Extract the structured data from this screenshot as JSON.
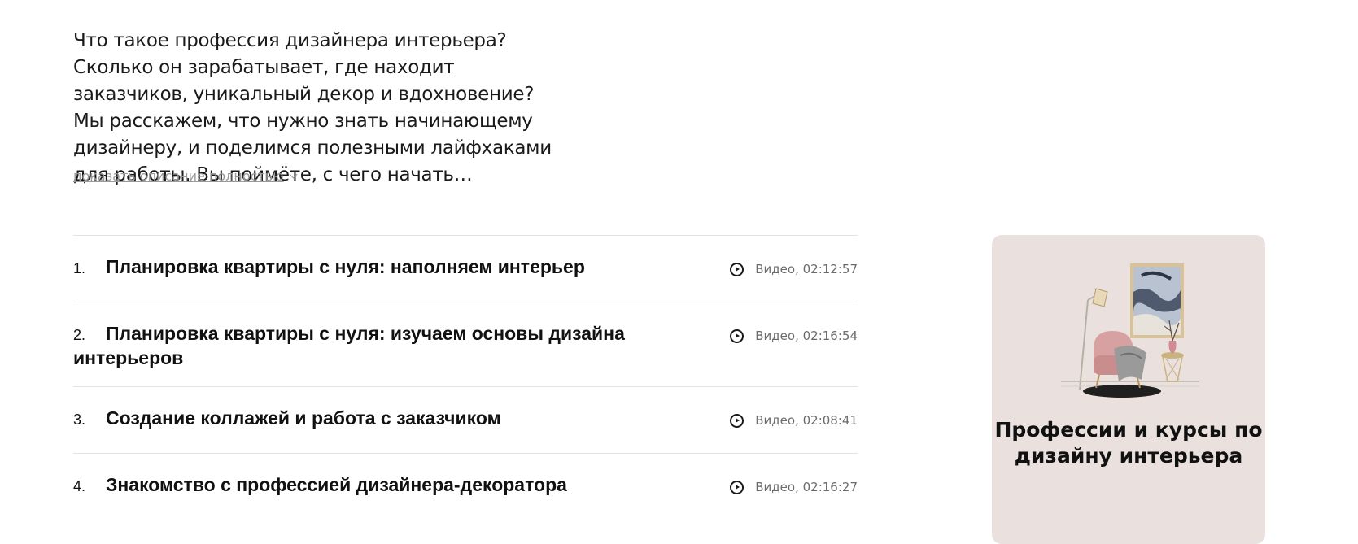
{
  "description": {
    "text": "Что такое профессия дизайнера интерьера? Сколько он зарабатывает, где находит заказчиков, уникальный декор и вдохновение? Мы расскажем, что нужно знать начинающему дизайнеру, и поделимся полезными лайфхаками для работы. Вы поймёте, с чего начать…",
    "show_more_label": "показать описание полностью"
  },
  "lessons": [
    {
      "number": "1.",
      "title": "Планировка квартиры с нуля: наполняем интерьер",
      "meta": "Видео, 02:12:57"
    },
    {
      "number": "2.",
      "title": "Планировка квартиры с нуля: изучаем основы дизайна интерьеров",
      "meta": "Видео, 02:16:54"
    },
    {
      "number": "3.",
      "title": "Создание коллажей и работа с заказчиком",
      "meta": "Видео, 02:08:41"
    },
    {
      "number": "4.",
      "title": "Знакомство с профессией дизайнера-декоратора",
      "meta": "Видео, 02:16:27"
    }
  ],
  "promo": {
    "title": "Профессии и курсы по дизайну интерьера",
    "background_color": "#eae0de"
  },
  "icons": {
    "lesson_type": "play-circle-icon",
    "show_more": "chevron-down-icon"
  }
}
